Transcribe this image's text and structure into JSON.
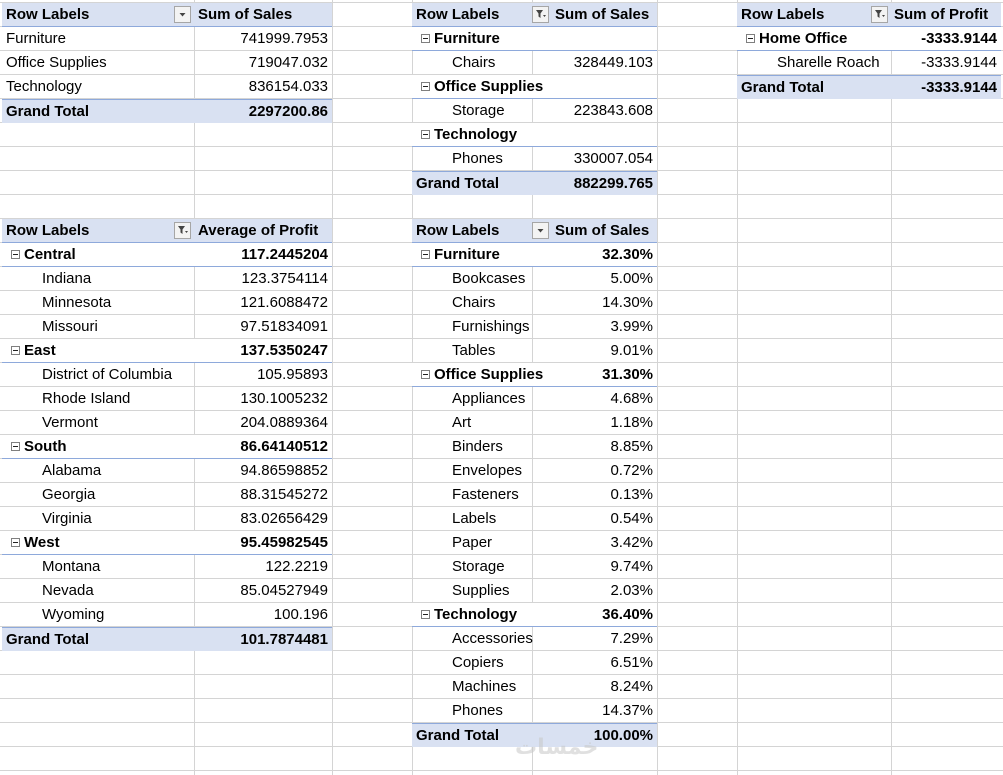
{
  "pt1": {
    "header": {
      "label": "Row Labels",
      "value": "Sum of Sales"
    },
    "rows": [
      {
        "label": "Furniture",
        "value": "741999.7953"
      },
      {
        "label": "Office Supplies",
        "value": "719047.032"
      },
      {
        "label": "Technology",
        "value": "836154.033"
      }
    ],
    "total": {
      "label": "Grand Total",
      "value": "2297200.86"
    }
  },
  "pt2": {
    "header": {
      "label": "Row Labels",
      "value": "Sum of Sales"
    },
    "groups": [
      {
        "label": "Furniture",
        "children": [
          {
            "label": "Chairs",
            "value": "328449.103"
          }
        ]
      },
      {
        "label": "Office Supplies",
        "children": [
          {
            "label": "Storage",
            "value": "223843.608"
          }
        ]
      },
      {
        "label": "Technology",
        "children": [
          {
            "label": "Phones",
            "value": "330007.054"
          }
        ]
      }
    ],
    "total": {
      "label": "Grand Total",
      "value": "882299.765"
    }
  },
  "pt3": {
    "header": {
      "label": "Row Labels",
      "value": "Sum of Profit"
    },
    "groups": [
      {
        "label": "Home Office",
        "value": "-3333.9144",
        "children": [
          {
            "label": "Sharelle Roach",
            "value": "-3333.9144"
          }
        ]
      }
    ],
    "total": {
      "label": "Grand Total",
      "value": "-3333.9144"
    }
  },
  "pt4": {
    "header": {
      "label": "Row Labels",
      "value": "Average of Profit"
    },
    "groups": [
      {
        "label": "Central",
        "value": "117.2445204",
        "children": [
          {
            "label": "Indiana",
            "value": "123.3754114"
          },
          {
            "label": "Minnesota",
            "value": "121.6088472"
          },
          {
            "label": "Missouri",
            "value": "97.51834091"
          }
        ]
      },
      {
        "label": "East",
        "value": "137.5350247",
        "children": [
          {
            "label": "District of Columbia",
            "value": "105.95893"
          },
          {
            "label": "Rhode Island",
            "value": "130.1005232"
          },
          {
            "label": "Vermont",
            "value": "204.0889364"
          }
        ]
      },
      {
        "label": "South",
        "value": "86.64140512",
        "children": [
          {
            "label": "Alabama",
            "value": "94.86598852"
          },
          {
            "label": "Georgia",
            "value": "88.31545272"
          },
          {
            "label": "Virginia",
            "value": "83.02656429"
          }
        ]
      },
      {
        "label": "West",
        "value": "95.45982545",
        "children": [
          {
            "label": "Montana",
            "value": "122.2219"
          },
          {
            "label": "Nevada",
            "value": "85.04527949"
          },
          {
            "label": "Wyoming",
            "value": "100.196"
          }
        ]
      }
    ],
    "total": {
      "label": "Grand Total",
      "value": "101.7874481"
    }
  },
  "pt5": {
    "header": {
      "label": "Row Labels",
      "value": "Sum of Sales"
    },
    "groups": [
      {
        "label": "Furniture",
        "value": "32.30%",
        "children": [
          {
            "label": "Bookcases",
            "value": "5.00%"
          },
          {
            "label": "Chairs",
            "value": "14.30%"
          },
          {
            "label": "Furnishings",
            "value": "3.99%"
          },
          {
            "label": "Tables",
            "value": "9.01%"
          }
        ]
      },
      {
        "label": "Office Supplies",
        "value": "31.30%",
        "children": [
          {
            "label": "Appliances",
            "value": "4.68%"
          },
          {
            "label": "Art",
            "value": "1.18%"
          },
          {
            "label": "Binders",
            "value": "8.85%"
          },
          {
            "label": "Envelopes",
            "value": "0.72%"
          },
          {
            "label": "Fasteners",
            "value": "0.13%"
          },
          {
            "label": "Labels",
            "value": "0.54%"
          },
          {
            "label": "Paper",
            "value": "3.42%"
          },
          {
            "label": "Storage",
            "value": "9.74%"
          },
          {
            "label": "Supplies",
            "value": "2.03%"
          }
        ]
      },
      {
        "label": "Technology",
        "value": "36.40%",
        "children": [
          {
            "label": "Accessories",
            "value": "7.29%"
          },
          {
            "label": "Copiers",
            "value": "6.51%"
          },
          {
            "label": "Machines",
            "value": "8.24%"
          },
          {
            "label": "Phones",
            "value": "14.37%"
          }
        ]
      }
    ],
    "total": {
      "label": "Grand Total",
      "value": "100.00%"
    }
  },
  "watermark": "خمسات",
  "colors": {
    "header_bg": "#d9e1f2",
    "border": "#8ea9db",
    "gridline": "#d4d4d4"
  }
}
